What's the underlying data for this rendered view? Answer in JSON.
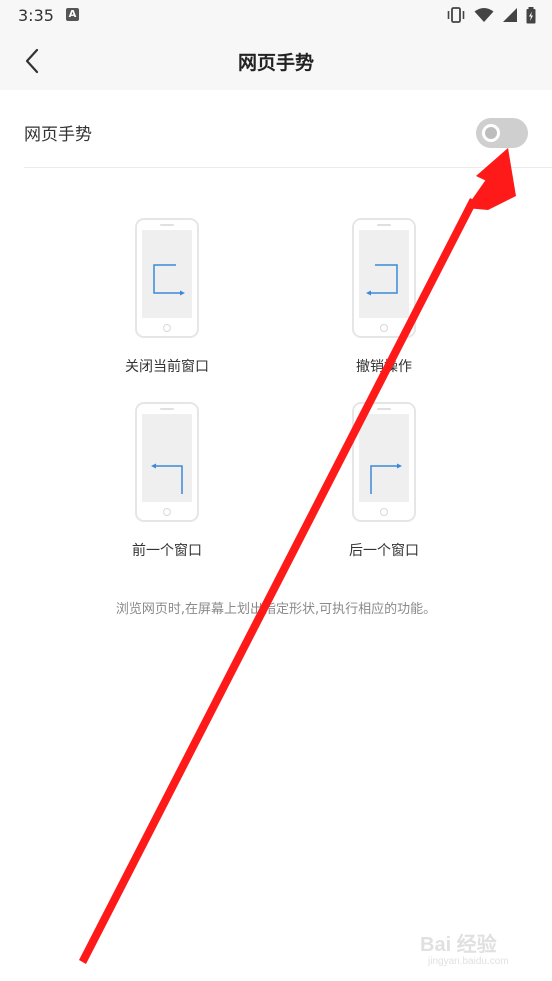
{
  "status_bar": {
    "time": "3:35",
    "notification_icon": "A"
  },
  "app_bar": {
    "title": "网页手势"
  },
  "setting": {
    "label": "网页手势",
    "toggle_on": false
  },
  "gestures": [
    {
      "label": "关闭当前窗口",
      "icon": "gesture-down-right-icon"
    },
    {
      "label": "撤销操作",
      "icon": "gesture-down-left-icon"
    },
    {
      "label": "前一个窗口",
      "icon": "gesture-left-down-icon"
    },
    {
      "label": "后一个窗口",
      "icon": "gesture-up-right-icon"
    }
  ],
  "hint": "浏览网页时,在屏幕上划出指定形状,可执行相应的功能。",
  "watermark": {
    "text": "Bai 经验",
    "sub": "jingyan.baidu.com"
  },
  "colors": {
    "gesture_blue": "#3b8ad9",
    "annotation_red": "#ff1a1a"
  }
}
